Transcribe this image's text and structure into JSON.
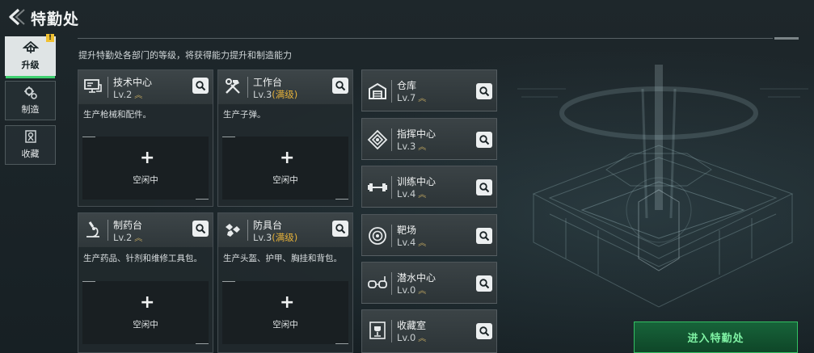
{
  "header": {
    "title": "特勤处"
  },
  "subtitle": "提升特勤处各部门的等级，将获得能力提升和制造能力",
  "tabs": [
    {
      "label": "升级",
      "icon": "upgrade-icon",
      "active": true,
      "badge": "!"
    },
    {
      "label": "制造",
      "icon": "gear-icon",
      "active": false
    },
    {
      "label": "收藏",
      "icon": "collection-icon",
      "active": false
    }
  ],
  "workshops": [
    {
      "name": "技术中心",
      "level": "Lv.2",
      "max": "",
      "desc": "生产枪械和配件。",
      "icon": "monitor-icon",
      "slot_label": "空闲中"
    },
    {
      "name": "工作台",
      "level": "Lv.3",
      "max": "(满级)",
      "desc": "生产子弹。",
      "icon": "hammer-wrench-icon",
      "slot_label": "空闲中"
    },
    {
      "name": "制药台",
      "level": "Lv.2",
      "max": "",
      "desc": "生产药品、针剂和维修工具包。",
      "icon": "microscope-icon",
      "slot_label": "空闲中"
    },
    {
      "name": "防具台",
      "level": "Lv.3",
      "max": "(满级)",
      "desc": "生产头盔、护甲、胸挂和背包。",
      "icon": "armor-icon",
      "slot_label": "空闲中"
    }
  ],
  "facilities": [
    {
      "name": "仓库",
      "level": "Lv.7",
      "icon": "warehouse-icon"
    },
    {
      "name": "指挥中心",
      "level": "Lv.3",
      "icon": "command-icon"
    },
    {
      "name": "训练中心",
      "level": "Lv.4",
      "icon": "dumbbell-icon"
    },
    {
      "name": "靶场",
      "level": "Lv.4",
      "icon": "target-icon"
    },
    {
      "name": "潜水中心",
      "level": "Lv.0",
      "icon": "diving-mask-icon"
    },
    {
      "name": "收藏室",
      "level": "Lv.0",
      "icon": "trophy-icon"
    }
  ],
  "enter_button": "进入特勤处",
  "colors": {
    "accent": "#33c063",
    "max_level": "#e6b23a",
    "badge": "#f0c030"
  }
}
